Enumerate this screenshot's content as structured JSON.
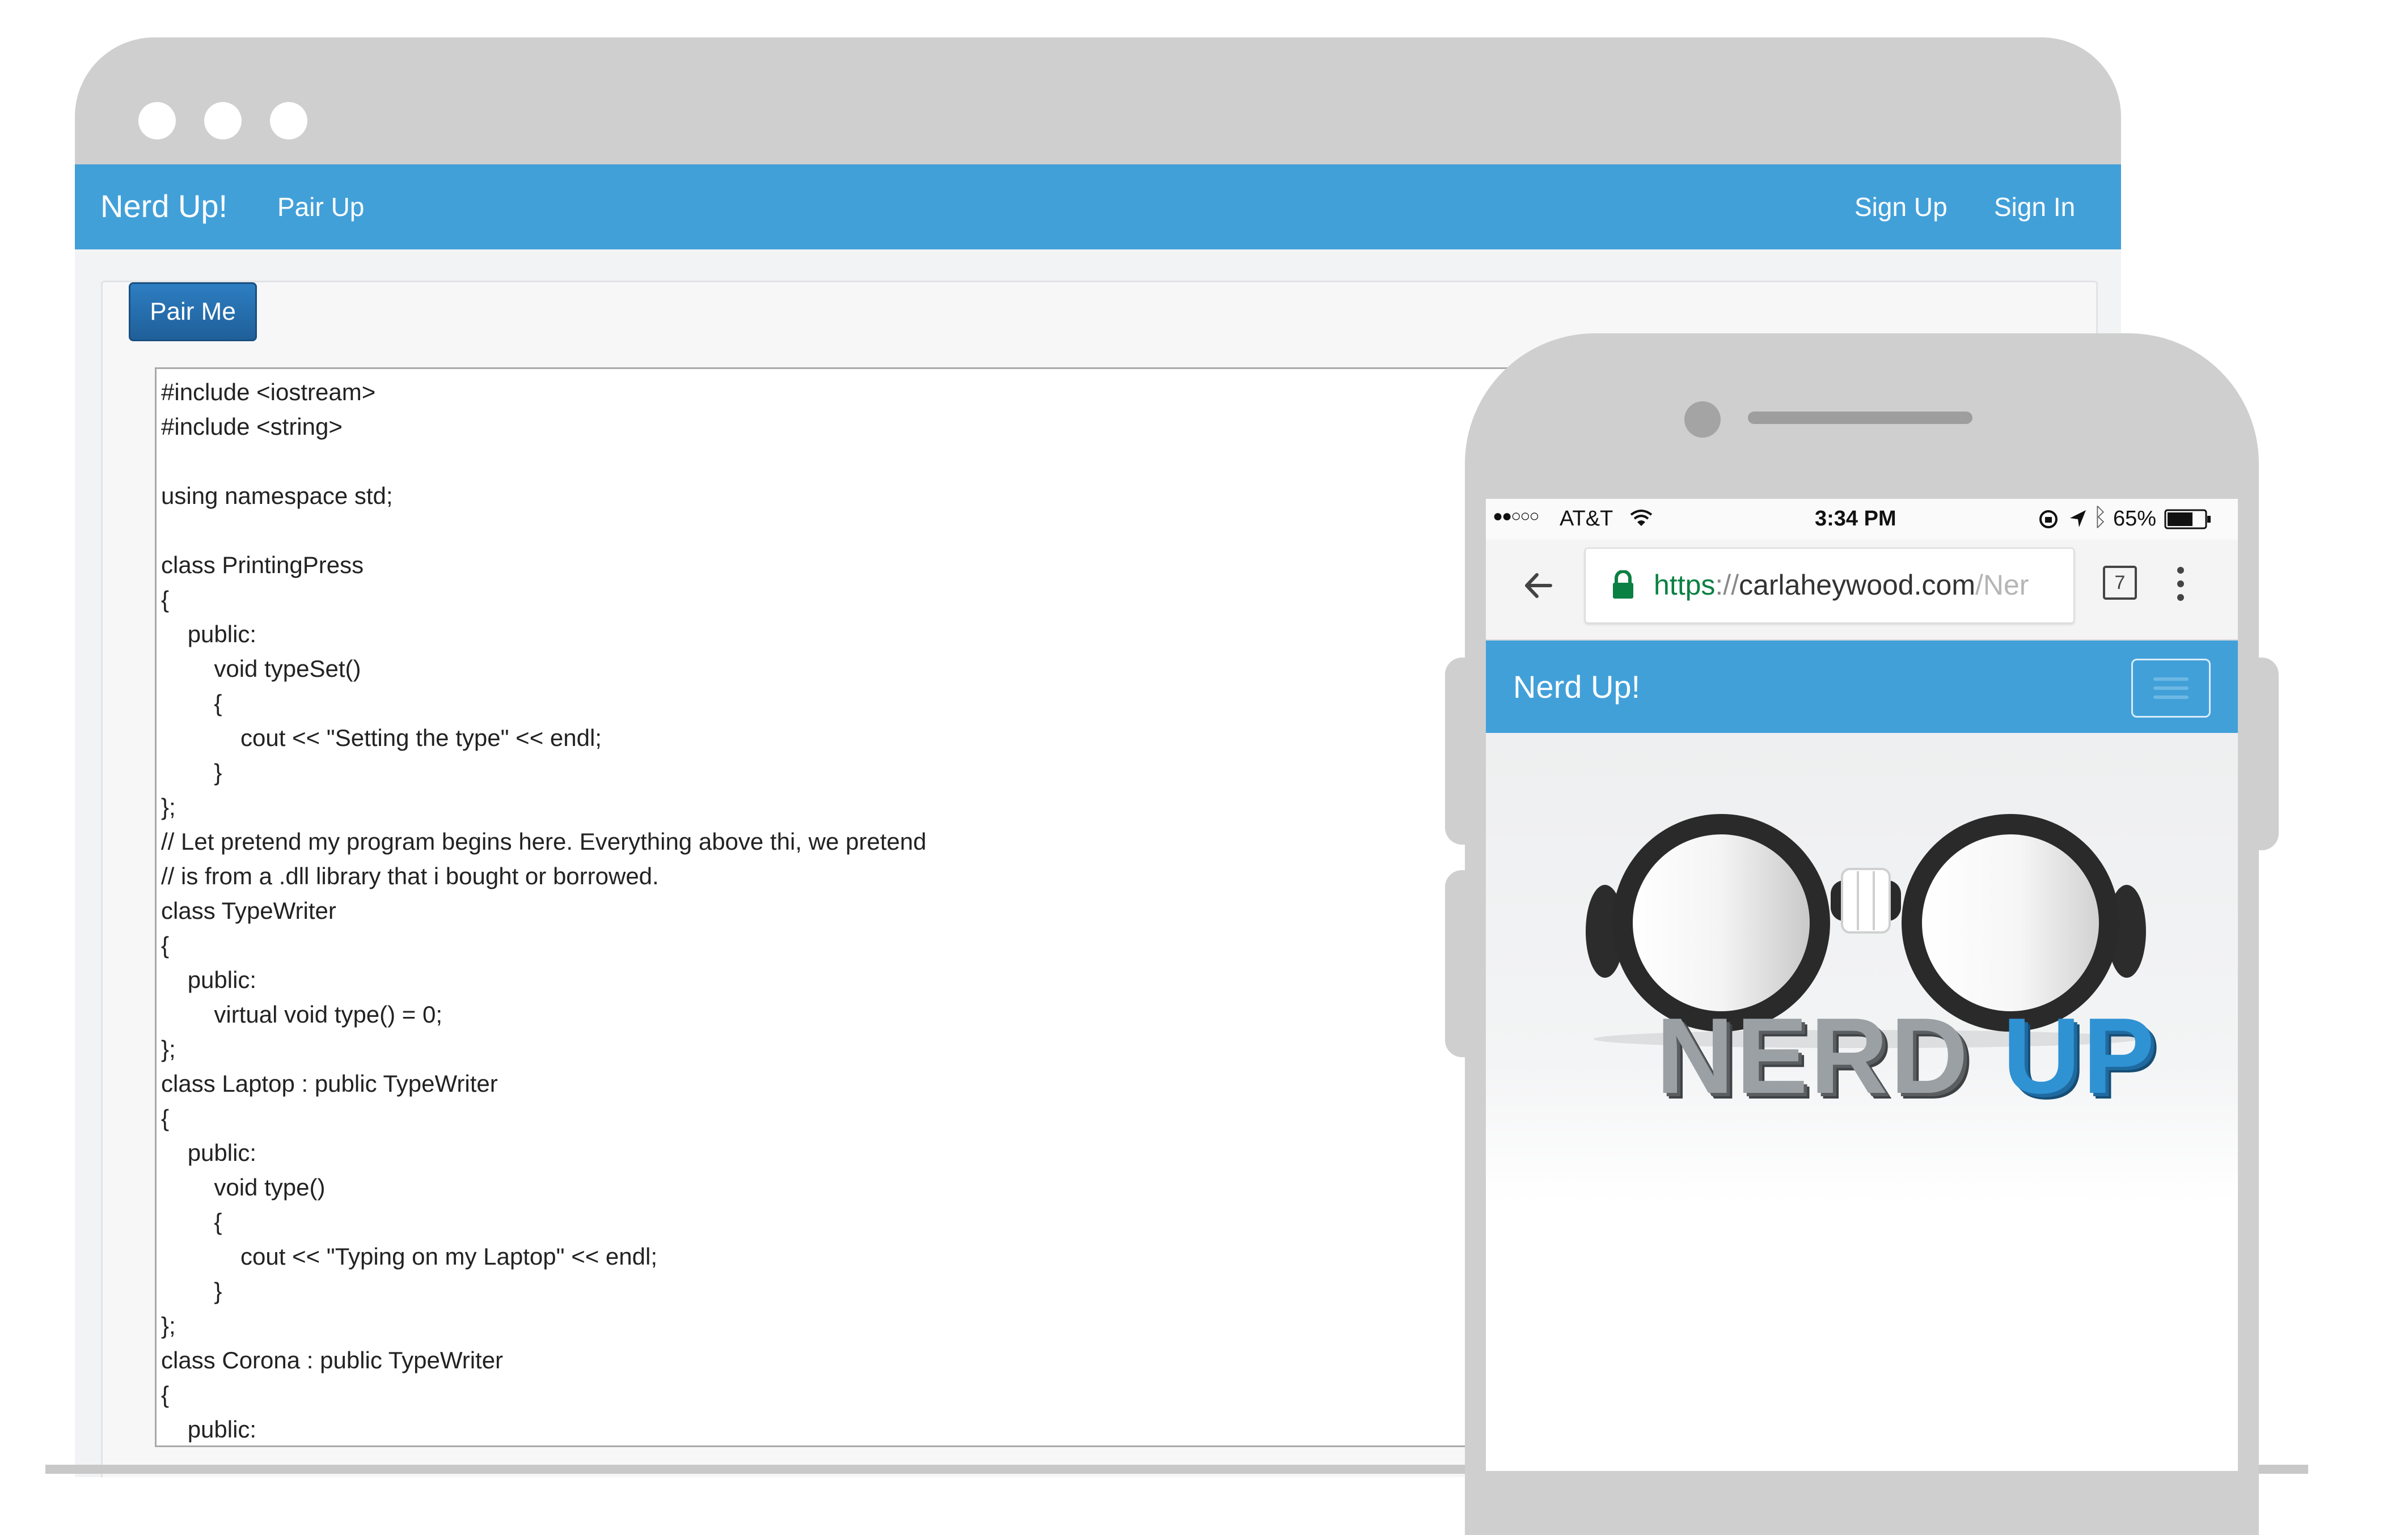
{
  "browser": {
    "navbar": {
      "brand": "Nerd Up!",
      "links": [
        "Pair Up"
      ],
      "right_links": [
        "Sign Up",
        "Sign In"
      ]
    },
    "pair_button_label": "Pair Me",
    "code": "#include <iostream>\n#include <string>\n\nusing namespace std;\n\nclass PrintingPress\n{\n\tpublic:\n\t\tvoid typeSet()\n\t\t{\n\t\t\tcout << \"Setting the type\" << endl;\n\t\t}\n};\n// Let pretend my program begins here. Everything above thi, we pretend\n// is from a .dll library that i bought or borrowed.\nclass TypeWriter\n{\n\tpublic:\n\t\tvirtual void type() = 0;\n};\nclass Laptop : public TypeWriter\n{\n\tpublic:\n\t\tvoid type()\n\t\t{\n\t\t\tcout << \"Typing on my Laptop\" << endl;\n\t\t}\n};\nclass Corona : public TypeWriter\n{\n\tpublic:"
  },
  "phone": {
    "status_bar": {
      "signal": "●●○○○",
      "carrier": "AT&T",
      "time": "3:34 PM",
      "battery": "65%"
    },
    "address_bar": {
      "scheme": "https",
      "separator": "://",
      "host": "carlaheywood.com",
      "path_fragment": "/Ner",
      "tab_count": "7"
    },
    "navbar": {
      "brand": "Nerd Up!"
    },
    "hero_logo": {
      "word1": "NERD",
      "word2": "UP"
    }
  },
  "colors": {
    "navbar": "#42a0d9",
    "button": "#2d7ec2",
    "frame": "#cfcfcf",
    "secure_green": "#0b8043"
  }
}
